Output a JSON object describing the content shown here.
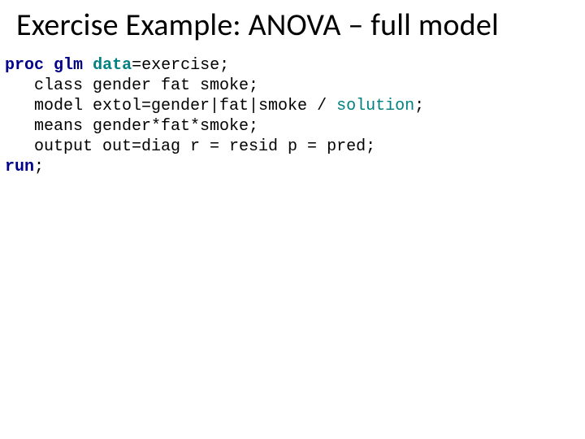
{
  "title": "Exercise Example: ANOVA – full model",
  "code": {
    "l1": {
      "proc": "proc",
      "glm": "glm",
      "data": "data",
      "eq": "=exercise;"
    },
    "l2": {
      "indent": "   class gender fat smoke;"
    },
    "l3": {
      "pre": "   model extol=gender|fat|smoke / ",
      "sol": "solution",
      "end": ";"
    },
    "l4": {
      "indent": "   means gender*fat*smoke;"
    },
    "l5": {
      "indent": "   output out=diag r = resid p = pred;"
    },
    "l6": {
      "run": "run",
      "end": ";"
    }
  }
}
